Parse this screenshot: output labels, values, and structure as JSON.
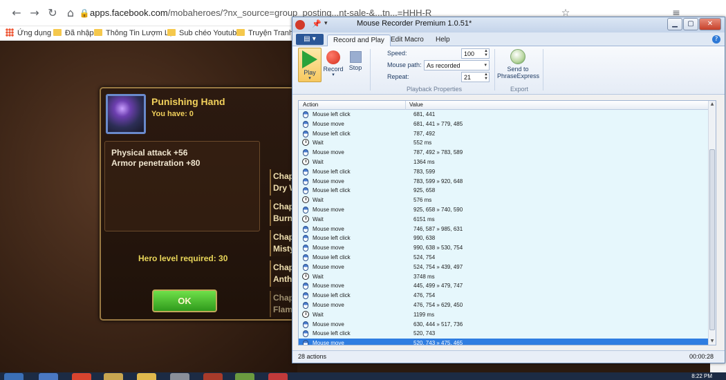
{
  "browser": {
    "url_host": "apps.facebook.com",
    "url_path": "/mobaheroes/?nx_source=group_posting...nt-sale-&...tn...=HHH-R",
    "bookmarks": [
      "Ứng dụng",
      "Đã nhập",
      "Thông Tin Lượm Lặt",
      "Sub chéo Youtube",
      "Truyện Tranh"
    ]
  },
  "game": {
    "item_name": "Punishing Hand",
    "you_have": "You have: 0",
    "stats": [
      "Physical attack +56",
      "Armor penetration +80"
    ],
    "hero_level": "Hero level required:  30",
    "ok_label": "OK",
    "chapters": [
      {
        "title": "Chap",
        "sub": "Dry W"
      },
      {
        "title": "Chap",
        "sub": "Burn"
      },
      {
        "title": "Chap",
        "sub": "Misty"
      },
      {
        "title": "Chap",
        "sub": "Anth"
      },
      {
        "title": "Chap",
        "sub": "Flam"
      }
    ]
  },
  "recorder": {
    "title": "Mouse Recorder Premium 1.0.51*",
    "tabs": [
      "Record and Play",
      "Edit Macro",
      "Help"
    ],
    "active_tab": "Record and Play",
    "buttons": {
      "play": "Play",
      "record": "Record",
      "stop": "Stop",
      "send_to": "Send to",
      "phraseexpress": "PhraseExpress"
    },
    "properties": {
      "speed_label": "Speed:",
      "speed_value": "100",
      "mouse_path_label": "Mouse path:",
      "mouse_path_value": "As recorded",
      "repeat_label": "Repeat:",
      "repeat_value": "21"
    },
    "groups": {
      "playback": "Playback Properties",
      "export": "Export"
    },
    "columns": {
      "action": "Action",
      "value": "Value"
    },
    "rows": [
      {
        "type": "mouse",
        "action": "Mouse left click",
        "value": "681, 441"
      },
      {
        "type": "mouse",
        "action": "Mouse move",
        "value": "681, 441 » 779, 485"
      },
      {
        "type": "mouse",
        "action": "Mouse left click",
        "value": "787, 492"
      },
      {
        "type": "wait",
        "action": "Wait",
        "value": "552 ms"
      },
      {
        "type": "mouse",
        "action": "Mouse move",
        "value": "787, 492 » 783, 589"
      },
      {
        "type": "wait",
        "action": "Wait",
        "value": "1364 ms"
      },
      {
        "type": "mouse",
        "action": "Mouse left click",
        "value": "783, 599"
      },
      {
        "type": "mouse",
        "action": "Mouse move",
        "value": "783, 599 » 920, 648"
      },
      {
        "type": "mouse",
        "action": "Mouse left click",
        "value": "925, 658"
      },
      {
        "type": "wait",
        "action": "Wait",
        "value": "576 ms"
      },
      {
        "type": "mouse",
        "action": "Mouse move",
        "value": "925, 658 » 740, 590"
      },
      {
        "type": "wait",
        "action": "Wait",
        "value": "6151 ms"
      },
      {
        "type": "mouse",
        "action": "Mouse move",
        "value": "746, 587 » 985, 631"
      },
      {
        "type": "mouse",
        "action": "Mouse left click",
        "value": "990, 638"
      },
      {
        "type": "mouse",
        "action": "Mouse move",
        "value": "990, 638 » 530, 754"
      },
      {
        "type": "mouse",
        "action": "Mouse left click",
        "value": "524, 754"
      },
      {
        "type": "mouse",
        "action": "Mouse move",
        "value": "524, 754 » 439, 497"
      },
      {
        "type": "wait",
        "action": "Wait",
        "value": "3748 ms"
      },
      {
        "type": "mouse",
        "action": "Mouse move",
        "value": "445, 499 » 479, 747"
      },
      {
        "type": "mouse",
        "action": "Mouse left click",
        "value": "476, 754"
      },
      {
        "type": "mouse",
        "action": "Mouse move",
        "value": "476, 754 » 629, 450"
      },
      {
        "type": "wait",
        "action": "Wait",
        "value": "1199 ms"
      },
      {
        "type": "mouse",
        "action": "Mouse move",
        "value": "630, 444 » 517, 736"
      },
      {
        "type": "mouse",
        "action": "Mouse left click",
        "value": "520, 743"
      },
      {
        "type": "mouse",
        "action": "Mouse move",
        "value": "520, 743 » 475, 465",
        "selected": true
      }
    ],
    "status_count": "28 actions",
    "status_time": "00:00:28"
  },
  "taskbar": {
    "clock": "8:22 PM"
  }
}
